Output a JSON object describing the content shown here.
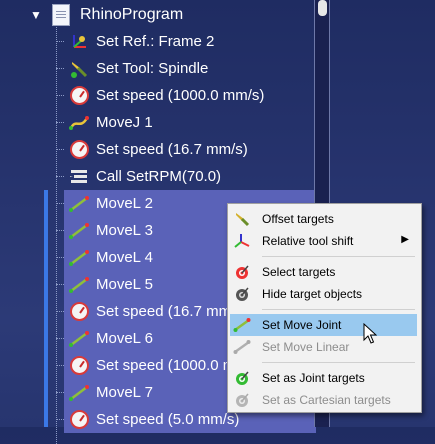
{
  "tree": {
    "root": {
      "label": "RhinoProgram",
      "toggle": "▼"
    },
    "items": [
      {
        "label": "Set Ref.: Frame 2",
        "icon": "reference-frame-icon",
        "selected": false
      },
      {
        "label": "Set Tool: Spindle",
        "icon": "tool-icon",
        "selected": false
      },
      {
        "label": "Set speed (1000.0 mm/s)",
        "icon": "speed-gauge-icon",
        "selected": false
      },
      {
        "label": "MoveJ 1",
        "icon": "move-joint-icon",
        "selected": false
      },
      {
        "label": "Set speed (16.7 mm/s)",
        "icon": "speed-gauge-icon",
        "selected": false
      },
      {
        "label": "Call SetRPM(70.0)",
        "icon": "program-call-icon",
        "selected": false
      },
      {
        "label": "MoveL 2",
        "icon": "move-linear-icon",
        "selected": true
      },
      {
        "label": "MoveL 3",
        "icon": "move-linear-icon",
        "selected": true
      },
      {
        "label": "MoveL 4",
        "icon": "move-linear-icon",
        "selected": true
      },
      {
        "label": "MoveL 5",
        "icon": "move-linear-icon",
        "selected": true
      },
      {
        "label": "Set speed (16.7 mm/s)",
        "icon": "speed-gauge-icon",
        "selected": true
      },
      {
        "label": "MoveL 6",
        "icon": "move-linear-icon",
        "selected": true
      },
      {
        "label": "Set speed (1000.0 mm/s)",
        "icon": "speed-gauge-icon",
        "selected": true
      },
      {
        "label": "MoveL 7",
        "icon": "move-linear-icon",
        "selected": true
      },
      {
        "label": "Set speed (5.0 mm/s)",
        "icon": "speed-gauge-icon",
        "selected": true
      }
    ]
  },
  "context_menu": {
    "items": [
      {
        "label": "Offset targets",
        "icon": "offset-targets-icon",
        "enabled": true,
        "highlighted": false
      },
      {
        "label": "Relative tool shift",
        "icon": "axes-icon",
        "enabled": true,
        "highlighted": false,
        "submenu": "▶"
      },
      {
        "label": "Select targets",
        "icon": "select-target-icon",
        "enabled": true,
        "highlighted": false
      },
      {
        "label": "Hide target objects",
        "icon": "hide-target-icon",
        "enabled": true,
        "highlighted": false
      },
      {
        "label": "Set Move Joint",
        "icon": "move-joint-icon",
        "enabled": true,
        "highlighted": true
      },
      {
        "label": "Set Move Linear",
        "icon": "move-linear-icon",
        "enabled": false,
        "highlighted": false
      },
      {
        "label": "Set as Joint targets",
        "icon": "joint-target-icon",
        "enabled": true,
        "highlighted": false
      },
      {
        "label": "Set as Cartesian targets",
        "icon": "cartesian-target-icon",
        "enabled": false,
        "highlighted": false
      }
    ]
  },
  "colors": {
    "background": "#26336d",
    "selection": "#5a62b8",
    "menu_highlight": "#99c9ef",
    "disabled_text": "#8d8d8d"
  }
}
